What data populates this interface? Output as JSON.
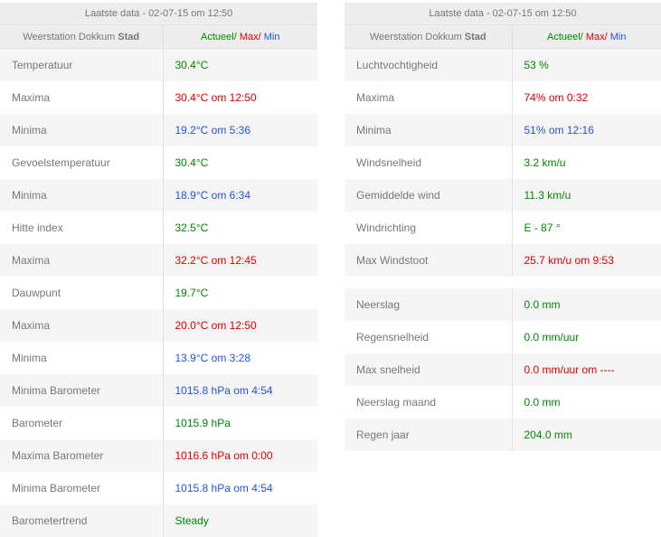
{
  "colors": {
    "actual": "#008800",
    "max": "#dd0000",
    "min": "#2255dd",
    "header_bg": "#ededed",
    "row_alt_bg": "#f5f5f5"
  },
  "left": {
    "timestamp": "Laatste data - 02-07-15 om 12:50",
    "station_prefix": "Weerstation Dokkum ",
    "station_bold": "Stad",
    "legend_actual": "Actueel/",
    "legend_max": " Max/",
    "legend_min": " Min",
    "rows": [
      {
        "label": "Temperatuur",
        "value": "30.4°C",
        "kind": "actual"
      },
      {
        "label": "Maxima",
        "value": "30.4°C om 12:50",
        "kind": "max"
      },
      {
        "label": "Minima",
        "value": "19.2°C om 5:36",
        "kind": "min"
      },
      {
        "label": "Gevoelstemperatuur",
        "value": "30.4°C",
        "kind": "actual"
      },
      {
        "label": "Minima",
        "value": "18.9°C om 6:34",
        "kind": "min"
      },
      {
        "label": "Hitte index",
        "value": "32.5°C",
        "kind": "actual"
      },
      {
        "label": "Maxima",
        "value": "32.2°C om 12:45",
        "kind": "max"
      },
      {
        "label": "Dauwpunt",
        "value": "19.7°C",
        "kind": "actual"
      },
      {
        "label": "Maxima",
        "value": "20.0°C om 12:50",
        "kind": "max"
      },
      {
        "label": "Minima",
        "value": "13.9°C om 3:28",
        "kind": "min"
      },
      {
        "label": "Minima Barometer",
        "value": "1015.8 hPa om 4:54",
        "kind": "min"
      },
      {
        "label": "Barometer",
        "value": "1015.9 hPa",
        "kind": "actual"
      },
      {
        "label": "Maxima Barometer",
        "value": "1016.6 hPa om 0:00",
        "kind": "max"
      },
      {
        "label": "Minima Barometer",
        "value": "1015.8 hPa om 4:54",
        "kind": "min"
      },
      {
        "label": "Barometertrend",
        "value": "Steady",
        "kind": "actual"
      }
    ]
  },
  "right": {
    "timestamp": "Laatste data - 02-07-15 om 12:50",
    "station_prefix": "Weerstation Dokkum ",
    "station_bold": "Stad",
    "legend_actual": "Actueel/",
    "legend_max": " Max/",
    "legend_min": " Min",
    "group1": [
      {
        "label": "Luchtvochtigheid",
        "value": "53 %",
        "kind": "actual"
      },
      {
        "label": "Maxima",
        "value": "74% om 0:32",
        "kind": "max"
      },
      {
        "label": "Minima",
        "value": "51% om 12:16",
        "kind": "min"
      },
      {
        "label": "Windsnelheid",
        "value": "3.2 km/u",
        "kind": "actual"
      },
      {
        "label": "Gemiddelde wind",
        "value": "11.3 km/u",
        "kind": "actual"
      },
      {
        "label": "Windrichting",
        "value": "E - 87 °",
        "kind": "actual"
      },
      {
        "label": "Max Windstoot",
        "value": "25.7 km/u om 9:53",
        "kind": "max"
      }
    ],
    "group2": [
      {
        "label": "Neerslag",
        "value": "0.0 mm",
        "kind": "actual"
      },
      {
        "label": "Regensnelheid",
        "value": "0.0 mm/uur",
        "kind": "actual"
      },
      {
        "label": "Max snelheid",
        "value": "0.0 mm/uur om ----",
        "kind": "max"
      },
      {
        "label": "Neerslag maand",
        "value": "0.0 mm",
        "kind": "actual"
      },
      {
        "label": "Regen jaar",
        "value": "204.0 mm",
        "kind": "actual"
      }
    ]
  }
}
